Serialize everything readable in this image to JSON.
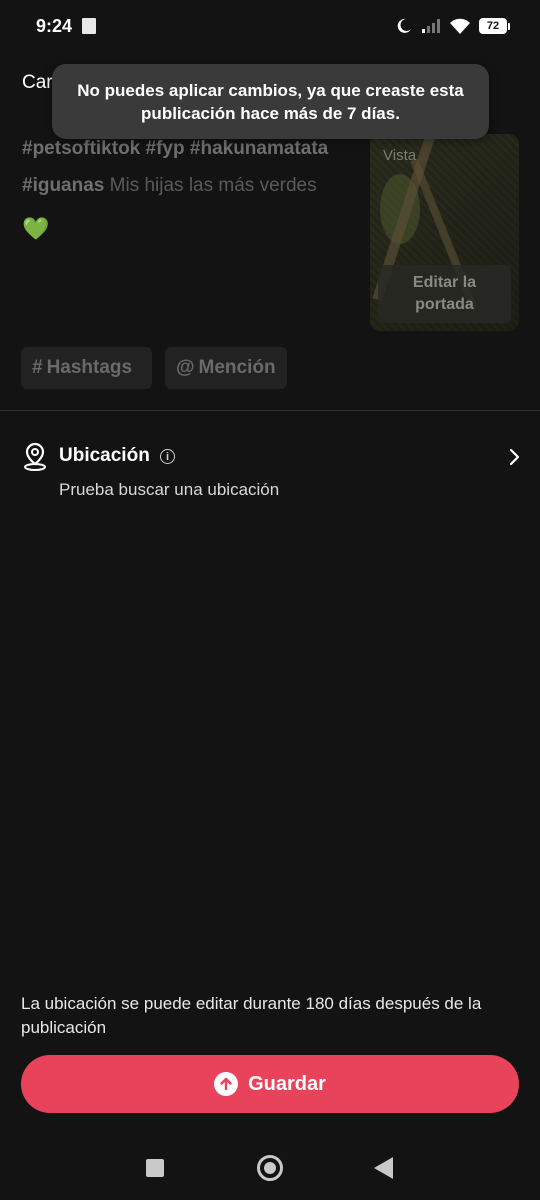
{
  "status_bar": {
    "time": "9:24",
    "battery": "72"
  },
  "caption": {
    "label": "Car",
    "tag1": "#petsoftiktok",
    "tag2": "#fyp",
    "tag3": "#hakunamatata",
    "tag4": "#iguanas",
    "text": "Mis hijas las más verdes",
    "emoji": "💚"
  },
  "toast": {
    "line1": "No puedes aplicar cambios, ya que creaste esta",
    "line2": "publicación hace más de 7 días."
  },
  "cover": {
    "preview_label": "Vista",
    "edit_line1": "Editar la",
    "edit_line2": "portada"
  },
  "chips": {
    "hashtags": "Hashtags",
    "mention": "Mención"
  },
  "location": {
    "title": "Ubicación",
    "info": "i",
    "subtitle": "Prueba buscar una ubicación"
  },
  "footer": {
    "note_line1": "La ubicación se puede editar durante 180 días después de la",
    "note_line2": "publicación",
    "save_label": "Guardar"
  },
  "colors": {
    "background": "#131313",
    "accent": "#e8435a",
    "toast": "#3a3a3a",
    "chip": "#222222"
  }
}
